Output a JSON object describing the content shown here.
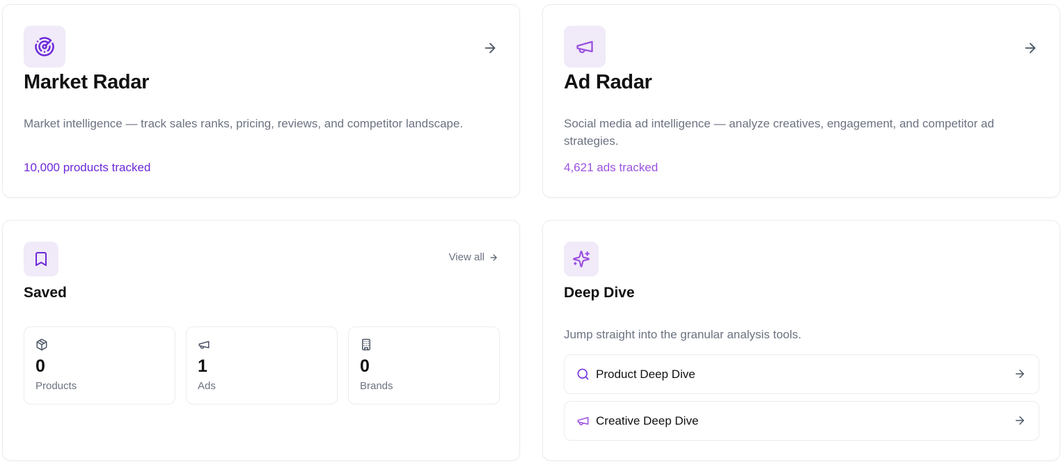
{
  "colors": {
    "accent": "#6d28d9",
    "accent_light": "#9b51e0",
    "tile_bg": "#f0eaf9",
    "muted_text": "#6b7280",
    "border": "#ececf1"
  },
  "market_radar": {
    "icon": "radar-icon",
    "title": "Market Radar",
    "description": "Market intelligence — track sales ranks, pricing, reviews, and competitor landscape.",
    "stat": "10,000 products tracked",
    "arrow_icon": "arrow-right-icon"
  },
  "ad_radar": {
    "icon": "megaphone-icon",
    "title": "Ad Radar",
    "description": "Social media ad intelligence — analyze creatives, engagement, and competitor ad strategies.",
    "stat": "4,621 ads tracked",
    "arrow_icon": "arrow-right-icon"
  },
  "saved": {
    "icon": "bookmark-icon",
    "title": "Saved",
    "view_all_label": "View all",
    "items": [
      {
        "icon": "package-icon",
        "value": "0",
        "label": "Products"
      },
      {
        "icon": "megaphone-icon",
        "value": "1",
        "label": "Ads"
      },
      {
        "icon": "building-icon",
        "value": "0",
        "label": "Brands"
      }
    ]
  },
  "deep_dive": {
    "icon": "sparkles-icon",
    "title": "Deep Dive",
    "description": "Jump straight into the granular analysis tools.",
    "links": [
      {
        "icon": "search-icon",
        "label": "Product Deep Dive"
      },
      {
        "icon": "megaphone-icon",
        "label": "Creative Deep Dive"
      }
    ]
  }
}
